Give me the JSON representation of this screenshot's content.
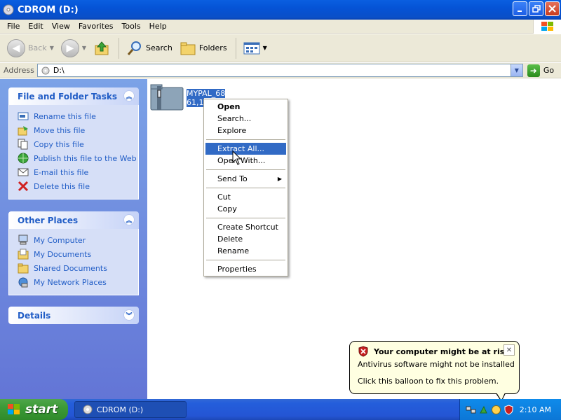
{
  "window": {
    "title": "CDROM (D:)"
  },
  "menu": [
    "File",
    "Edit",
    "View",
    "Favorites",
    "Tools",
    "Help"
  ],
  "toolbar": {
    "back": "Back",
    "search": "Search",
    "folders": "Folders"
  },
  "address": {
    "label": "Address",
    "value": "D:\\",
    "go": "Go"
  },
  "tasks": {
    "title": "File and Folder Tasks",
    "items": [
      {
        "label": "Rename this file",
        "icon": "rename-icon"
      },
      {
        "label": "Move this file",
        "icon": "move-icon"
      },
      {
        "label": "Copy this file",
        "icon": "copy-icon"
      },
      {
        "label": "Publish this file to the Web",
        "icon": "globe-icon"
      },
      {
        "label": "E-mail this file",
        "icon": "email-icon"
      },
      {
        "label": "Delete this file",
        "icon": "delete-icon"
      }
    ]
  },
  "places": {
    "title": "Other Places",
    "items": [
      {
        "label": "My Computer",
        "icon": "computer-icon"
      },
      {
        "label": "My Documents",
        "icon": "documents-folder-icon"
      },
      {
        "label": "Shared Documents",
        "icon": "shared-folder-icon"
      },
      {
        "label": "My Network Places",
        "icon": "network-icon"
      }
    ]
  },
  "details": {
    "title": "Details"
  },
  "file": {
    "line1": "MYPAL_68",
    "line2": "61,1"
  },
  "context_menu": {
    "open": "Open",
    "search": "Search...",
    "explore": "Explore",
    "extract_all": "Extract All...",
    "open_with": "Open With...",
    "send_to": "Send To",
    "cut": "Cut",
    "copy": "Copy",
    "create_shortcut": "Create Shortcut",
    "delete": "Delete",
    "rename": "Rename",
    "properties": "Properties"
  },
  "balloon": {
    "title": "Your computer might be at risk",
    "line1": "Antivirus software might not be installed",
    "line2": "Click this balloon to fix this problem."
  },
  "taskbar": {
    "start": "start",
    "task_item": "CDROM (D:)",
    "clock": "2:10 AM"
  },
  "colors": {
    "titlebar": "#0553d6",
    "selection": "#316ac5",
    "taskpane_link": "#215dc6",
    "balloon_bg": "#ffffe1"
  }
}
